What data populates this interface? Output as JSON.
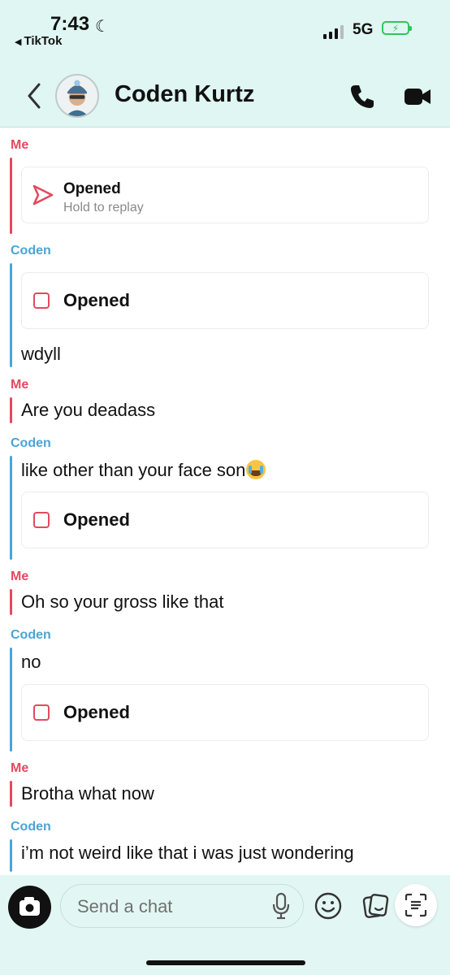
{
  "status_bar": {
    "time": "7:43",
    "back_app": "TikTok",
    "network": "5G",
    "icons": [
      "moon-icon",
      "signal-icon",
      "battery-charging-icon"
    ]
  },
  "header": {
    "contact_name": "Coden Kurtz",
    "icons": [
      "back-chevron-icon",
      "avatar",
      "phone-icon",
      "video-camera-icon"
    ]
  },
  "labels": {
    "me": "Me",
    "coden": "Coden"
  },
  "messages": {
    "m1_snap_status": "Opened",
    "m1_snap_hint": "Hold to replay",
    "m2_snap_status": "Opened",
    "m2_text": "wdyll",
    "m3_text": "Are you deadass",
    "m4_text": "like other than your face son",
    "m4_snap_status": "Opened",
    "m5_text": "Oh so your gross like that",
    "m6_text": "no",
    "m6_snap_status": "Opened",
    "m7_text": "Brotha what now",
    "m8_text": "i’m not weird like that i was just wondering"
  },
  "composer": {
    "placeholder": "Send a chat",
    "icons": [
      "camera-icon",
      "microphone-icon",
      "smiley-icon",
      "sticker-icon",
      "scan-icon"
    ]
  },
  "colors": {
    "header_bg": "#dff6f2",
    "me_accent": "#e24a5e",
    "coden_accent": "#4aa4d6",
    "battery": "#35c35a"
  }
}
